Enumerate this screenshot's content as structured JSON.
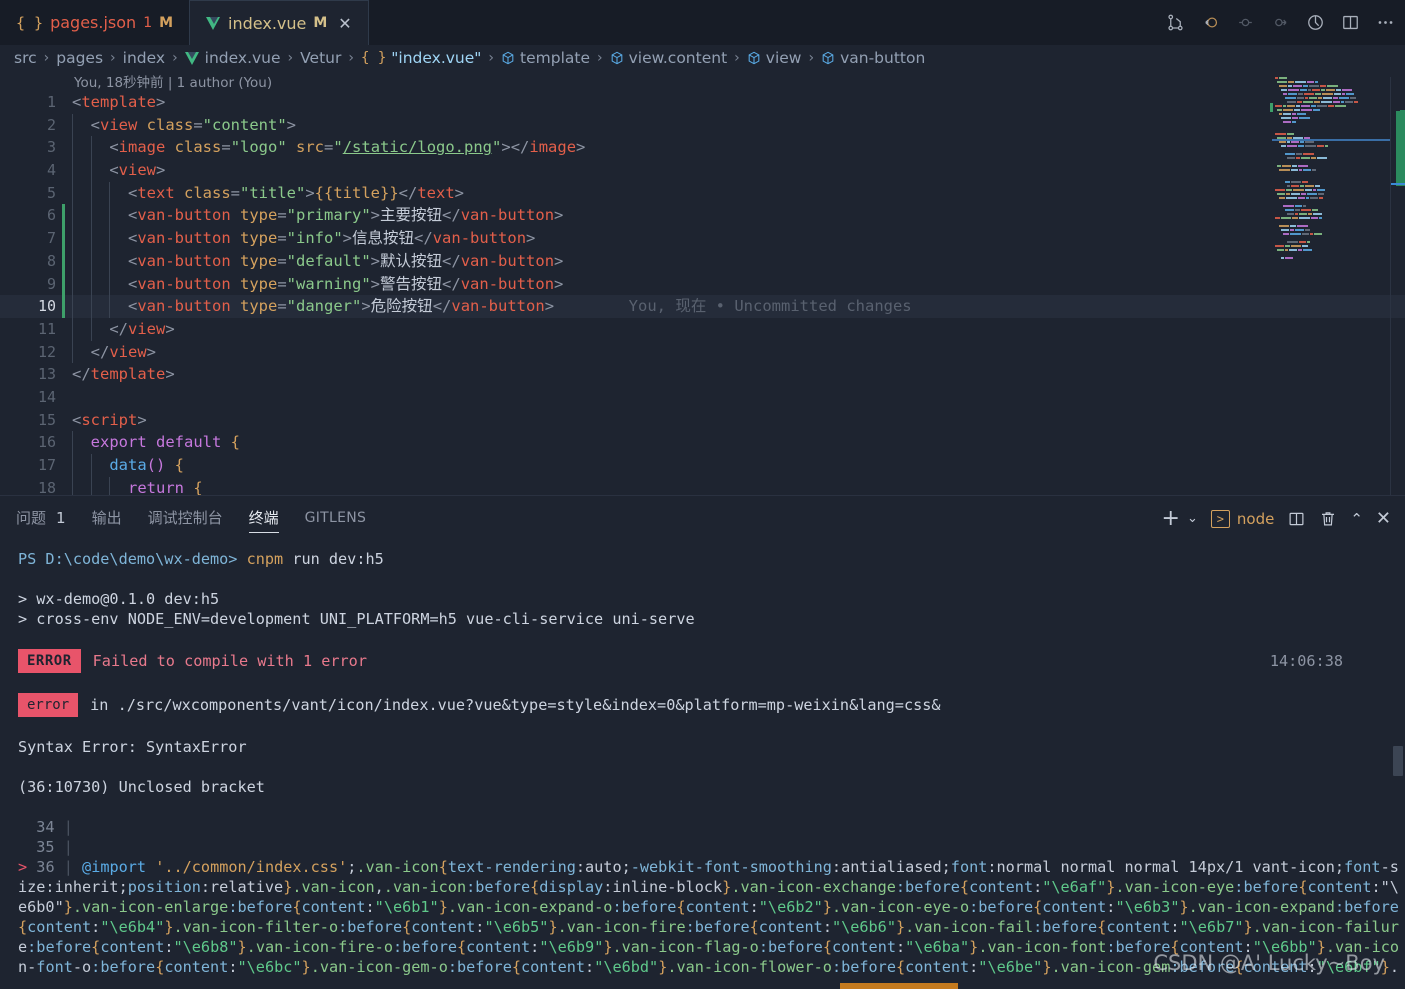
{
  "tabs": [
    {
      "icon": "json-icon",
      "name": "pages.json",
      "badge_num": "1",
      "badge_mod": "M",
      "active": false
    },
    {
      "icon": "vue-icon",
      "name": "index.vue",
      "badge_mod": "M",
      "active": true,
      "close": "✕"
    }
  ],
  "titlebar_icons": [
    "source-control-icon",
    "go-back-icon",
    "revert-icon",
    "forward-icon",
    "debug-icon",
    "split-editor-icon",
    "more-actions-icon"
  ],
  "breadcrumb": [
    {
      "label": "src",
      "icon": ""
    },
    {
      "label": "pages",
      "icon": ""
    },
    {
      "label": "index",
      "icon": ""
    },
    {
      "label": "index.vue",
      "icon": "vue-icon"
    },
    {
      "label": "Vetur",
      "icon": ""
    },
    {
      "label": "\"index.vue\"",
      "icon": "json-braces"
    },
    {
      "label": "template",
      "icon": "cube-icon"
    },
    {
      "label": "view.content",
      "icon": "cube-icon"
    },
    {
      "label": "view",
      "icon": "cube-icon"
    },
    {
      "label": "van-button",
      "icon": "cube-icon"
    }
  ],
  "editor": {
    "blame_header": "You, 18秒钟前 | 1 author (You)",
    "inline_blame": "You, 现在 • Uncommitted changes",
    "current_line": 10,
    "lines": [
      {
        "n": 1,
        "indent": 0,
        "tokens": [
          {
            "t": "<",
            "c": "t-punc"
          },
          {
            "t": "template",
            "c": "t-tag"
          },
          {
            "t": ">",
            "c": "t-punc"
          }
        ]
      },
      {
        "n": 2,
        "indent": 1,
        "tokens": [
          {
            "t": "  <",
            "c": "t-punc"
          },
          {
            "t": "view",
            "c": "t-tag"
          },
          {
            "t": " class",
            "c": "t-attr"
          },
          {
            "t": "=",
            "c": "t-punc"
          },
          {
            "t": "\"content\"",
            "c": "t-str"
          },
          {
            "t": ">",
            "c": "t-punc"
          }
        ]
      },
      {
        "n": 3,
        "indent": 2,
        "tokens": [
          {
            "t": "    <",
            "c": "t-punc"
          },
          {
            "t": "image",
            "c": "t-tag"
          },
          {
            "t": " class",
            "c": "t-attr"
          },
          {
            "t": "=",
            "c": "t-punc"
          },
          {
            "t": "\"logo\"",
            "c": "t-str"
          },
          {
            "t": " src",
            "c": "t-attr"
          },
          {
            "t": "=",
            "c": "t-punc"
          },
          {
            "t": "\"",
            "c": "t-str"
          },
          {
            "t": "/static/logo.png",
            "c": "t-str-l"
          },
          {
            "t": "\"",
            "c": "t-str"
          },
          {
            "t": ">",
            "c": "t-punc"
          },
          {
            "t": "</",
            "c": "t-punc"
          },
          {
            "t": "image",
            "c": "t-tag"
          },
          {
            "t": ">",
            "c": "t-punc"
          }
        ]
      },
      {
        "n": 4,
        "indent": 2,
        "tokens": [
          {
            "t": "    <",
            "c": "t-punc"
          },
          {
            "t": "view",
            "c": "t-tag"
          },
          {
            "t": ">",
            "c": "t-punc"
          }
        ]
      },
      {
        "n": 5,
        "indent": 3,
        "tokens": [
          {
            "t": "      <",
            "c": "t-punc"
          },
          {
            "t": "text",
            "c": "t-tag"
          },
          {
            "t": " class",
            "c": "t-attr"
          },
          {
            "t": "=",
            "c": "t-punc"
          },
          {
            "t": "\"title\"",
            "c": "t-str"
          },
          {
            "t": ">",
            "c": "t-punc"
          },
          {
            "t": "{{title}}",
            "c": "t-mus"
          },
          {
            "t": "</",
            "c": "t-punc"
          },
          {
            "t": "text",
            "c": "t-tag"
          },
          {
            "t": ">",
            "c": "t-punc"
          }
        ]
      },
      {
        "n": 6,
        "indent": 3,
        "mark": true,
        "tokens": [
          {
            "t": "      <",
            "c": "t-punc"
          },
          {
            "t": "van-button",
            "c": "t-tag"
          },
          {
            "t": " type",
            "c": "t-attr"
          },
          {
            "t": "=",
            "c": "t-punc"
          },
          {
            "t": "\"primary\"",
            "c": "t-str"
          },
          {
            "t": ">",
            "c": "t-punc"
          },
          {
            "t": "主要按钮",
            "c": "t-txt"
          },
          {
            "t": "</",
            "c": "t-punc"
          },
          {
            "t": "van-button",
            "c": "t-tag"
          },
          {
            "t": ">",
            "c": "t-punc"
          }
        ]
      },
      {
        "n": 7,
        "indent": 3,
        "mark": true,
        "tokens": [
          {
            "t": "      <",
            "c": "t-punc"
          },
          {
            "t": "van-button",
            "c": "t-tag"
          },
          {
            "t": " type",
            "c": "t-attr"
          },
          {
            "t": "=",
            "c": "t-punc"
          },
          {
            "t": "\"info\"",
            "c": "t-str"
          },
          {
            "t": ">",
            "c": "t-punc"
          },
          {
            "t": "信息按钮",
            "c": "t-txt"
          },
          {
            "t": "</",
            "c": "t-punc"
          },
          {
            "t": "van-button",
            "c": "t-tag"
          },
          {
            "t": ">",
            "c": "t-punc"
          }
        ]
      },
      {
        "n": 8,
        "indent": 3,
        "mark": true,
        "tokens": [
          {
            "t": "      <",
            "c": "t-punc"
          },
          {
            "t": "van-button",
            "c": "t-tag"
          },
          {
            "t": " type",
            "c": "t-attr"
          },
          {
            "t": "=",
            "c": "t-punc"
          },
          {
            "t": "\"default\"",
            "c": "t-str"
          },
          {
            "t": ">",
            "c": "t-punc"
          },
          {
            "t": "默认按钮",
            "c": "t-txt"
          },
          {
            "t": "</",
            "c": "t-punc"
          },
          {
            "t": "van-button",
            "c": "t-tag"
          },
          {
            "t": ">",
            "c": "t-punc"
          }
        ]
      },
      {
        "n": 9,
        "indent": 3,
        "mark": true,
        "tokens": [
          {
            "t": "      <",
            "c": "t-punc"
          },
          {
            "t": "van-button",
            "c": "t-tag"
          },
          {
            "t": " type",
            "c": "t-attr"
          },
          {
            "t": "=",
            "c": "t-punc"
          },
          {
            "t": "\"warning\"",
            "c": "t-str"
          },
          {
            "t": ">",
            "c": "t-punc"
          },
          {
            "t": "警告按钮",
            "c": "t-txt"
          },
          {
            "t": "</",
            "c": "t-punc"
          },
          {
            "t": "van-button",
            "c": "t-tag"
          },
          {
            "t": ">",
            "c": "t-punc"
          }
        ]
      },
      {
        "n": 10,
        "indent": 3,
        "mark": true,
        "current": true,
        "blame": true,
        "tokens": [
          {
            "t": "      <",
            "c": "t-punc"
          },
          {
            "t": "van-button",
            "c": "t-tag"
          },
          {
            "t": " type",
            "c": "t-attr"
          },
          {
            "t": "=",
            "c": "t-punc"
          },
          {
            "t": "\"danger\"",
            "c": "t-str"
          },
          {
            "t": ">",
            "c": "t-punc"
          },
          {
            "t": "危险按钮",
            "c": "t-txt"
          },
          {
            "t": "</",
            "c": "t-punc"
          },
          {
            "t": "van-button",
            "c": "t-tag"
          },
          {
            "t": ">",
            "c": "t-punc"
          }
        ]
      },
      {
        "n": 11,
        "indent": 2,
        "tokens": [
          {
            "t": "    </",
            "c": "t-punc"
          },
          {
            "t": "view",
            "c": "t-tag"
          },
          {
            "t": ">",
            "c": "t-punc"
          }
        ]
      },
      {
        "n": 12,
        "indent": 1,
        "tokens": [
          {
            "t": "  </",
            "c": "t-punc"
          },
          {
            "t": "view",
            "c": "t-tag"
          },
          {
            "t": ">",
            "c": "t-punc"
          }
        ]
      },
      {
        "n": 13,
        "indent": 0,
        "tokens": [
          {
            "t": "</",
            "c": "t-punc"
          },
          {
            "t": "template",
            "c": "t-tag"
          },
          {
            "t": ">",
            "c": "t-punc"
          }
        ]
      },
      {
        "n": 14,
        "indent": 0,
        "tokens": []
      },
      {
        "n": 15,
        "indent": 0,
        "tokens": [
          {
            "t": "<",
            "c": "t-punc"
          },
          {
            "t": "script",
            "c": "t-tag"
          },
          {
            "t": ">",
            "c": "t-punc"
          }
        ]
      },
      {
        "n": 16,
        "indent": 1,
        "tokens": [
          {
            "t": "  ",
            "c": "t-punc"
          },
          {
            "t": "export default",
            "c": "t-kw"
          },
          {
            "t": " {",
            "c": "t-brace"
          }
        ]
      },
      {
        "n": 17,
        "indent": 2,
        "tokens": [
          {
            "t": "    ",
            "c": "t-punc"
          },
          {
            "t": "data",
            "c": "t-fn"
          },
          {
            "t": "()",
            "c": "t-brace2"
          },
          {
            "t": " {",
            "c": "t-brace"
          }
        ]
      },
      {
        "n": 18,
        "indent": 3,
        "tokens": [
          {
            "t": "      ",
            "c": "t-punc"
          },
          {
            "t": "return",
            "c": "t-kw"
          },
          {
            "t": " {",
            "c": "t-brace"
          }
        ]
      }
    ]
  },
  "panel": {
    "tabs": [
      {
        "label": "问题",
        "count": "1",
        "active": false
      },
      {
        "label": "输出",
        "active": false
      },
      {
        "label": "调试控制台",
        "active": false
      },
      {
        "label": "终端",
        "active": true
      },
      {
        "label": "GITLENS",
        "active": false
      }
    ],
    "actions": {
      "new_terminal": "+",
      "new_terminal_dropdown": "⌄",
      "shell_name": "node",
      "split": "split-terminal-icon",
      "kill": "trash-icon",
      "maximize": "⌃",
      "close": "✕"
    }
  },
  "terminal": {
    "lines": [
      {
        "type": "prompt",
        "prefix": "PS D:\\code\\demo\\wx-demo> ",
        "cmd": "cnpm",
        "rest": " run dev:h5"
      },
      {
        "type": "blank"
      },
      {
        "type": "plain",
        "text": "> wx-demo@0.1.0 dev:h5"
      },
      {
        "type": "plain",
        "text": "> cross-env NODE_ENV=development UNI_PLATFORM=h5 vue-cli-service uni-serve"
      },
      {
        "type": "blank"
      },
      {
        "type": "error-badge",
        "badge": "ERROR",
        "text": "Failed to compile with 1 error",
        "time": "14:06:38"
      },
      {
        "type": "blank"
      },
      {
        "type": "error-badge2",
        "badge": "error",
        "text": "in ./src/wxcomponents/vant/icon/index.vue?vue&type=style&index=0&platform=mp-weixin&lang=css&"
      },
      {
        "type": "blank"
      },
      {
        "type": "plain",
        "text": "Syntax Error: SyntaxError"
      },
      {
        "type": "blank"
      },
      {
        "type": "plain",
        "text": "(36:10730) Unclosed bracket"
      },
      {
        "type": "blank"
      },
      {
        "type": "codeline",
        "num": "34",
        "text": ""
      },
      {
        "type": "codeline",
        "num": "35",
        "text": ""
      },
      {
        "type": "codeline-err",
        "num": "36",
        "arrow": ">",
        "text": "@import '../common/index.css';.van-icon{text-rendering:auto;-webkit-font-smoothing:antialiased;font:normal normal normal 14px/1 vant-icon;font-s"
      },
      {
        "type": "wrap",
        "text": "ize:inherit;position:relative}.van-icon,.van-icon:before{display:inline-block}.van-icon-exchange:before{content:\"\\e6af\"}.van-icon-eye:before{content:\"\\"
      },
      {
        "type": "wrap",
        "text": "e6b0\"}.van-icon-enlarge:before{content:\"\\e6b1\"}.van-icon-expand-o:before{content:\"\\e6b2\"}.van-icon-eye-o:before{content:\"\\e6b3\"}.van-icon-expand:before"
      },
      {
        "type": "wrap",
        "text": "{content:\"\\e6b4\"}.van-icon-filter-o:before{content:\"\\e6b5\"}.van-icon-fire:before{content:\"\\e6b6\"}.van-icon-fail:before{content:\"\\e6b7\"}.van-icon-failur"
      },
      {
        "type": "wrap",
        "text": "e:before{content:\"\\e6b8\"}.van-icon-fire-o:before{content:\"\\e6b9\"}.van-icon-flag-o:before{content:\"\\e6ba\"}.van-icon-font:before{content:\"\\e6bb\"}.van-ico"
      },
      {
        "type": "wrap",
        "text": "n-font-o:before{content:\"\\e6bc\"}.van-icon-gem-o:before{content:\"\\e6bd\"}.van-icon-flower-o:before{content:\"\\e6be\"}.van-icon-gem:before{content:\"\\e6bf\"}."
      }
    ]
  },
  "watermark": "CSDN @A' Lucky~Boy"
}
